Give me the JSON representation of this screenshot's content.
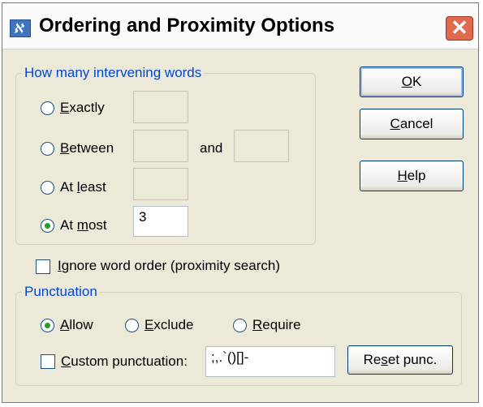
{
  "window": {
    "title": "Ordering and Proximity Options",
    "app_icon_glyph": "ℵ",
    "close_glyph": "✕"
  },
  "intervening": {
    "legend": "How many intervening words",
    "exactly": {
      "pre": "",
      "key": "E",
      "post": "xactly",
      "value": "",
      "checked": false
    },
    "between": {
      "pre": "",
      "key": "B",
      "post": "etween",
      "value": "",
      "value2": "",
      "checked": false
    },
    "and_label": "and",
    "at_least": {
      "pre": "At ",
      "key": "l",
      "post": "east",
      "value": "",
      "checked": false
    },
    "at_most": {
      "pre": "At ",
      "key": "m",
      "post": "ost",
      "value": "3",
      "checked": true
    }
  },
  "ignore_order": {
    "pre": "",
    "key": "I",
    "post": "gnore word order (proximity search)",
    "checked": false
  },
  "punctuation": {
    "legend": "Punctuation",
    "allow": {
      "pre": "",
      "key": "A",
      "post": "llow",
      "checked": true
    },
    "exclude": {
      "pre": "",
      "key": "E",
      "post": "xclude",
      "checked": false
    },
    "require": {
      "pre": "",
      "key": "R",
      "post": "equire",
      "checked": false
    },
    "custom": {
      "pre": "",
      "key": "C",
      "post": "ustom punctuation:",
      "checked": false,
      "value": ";,.`()[]-"
    },
    "reset": {
      "pre": "Re",
      "key": "s",
      "post": "et punc."
    }
  },
  "buttons": {
    "ok": {
      "pre": "",
      "key": "O",
      "post": "K"
    },
    "cancel": {
      "pre": "",
      "key": "C",
      "post": "ancel"
    },
    "help": {
      "pre": "",
      "key": "H",
      "post": "elp"
    }
  },
  "colors": {
    "accent": "#0046d5",
    "dialog_bg": "#ece9d8",
    "close_red": "#e06a4d",
    "radio_dot": "#21a121"
  }
}
